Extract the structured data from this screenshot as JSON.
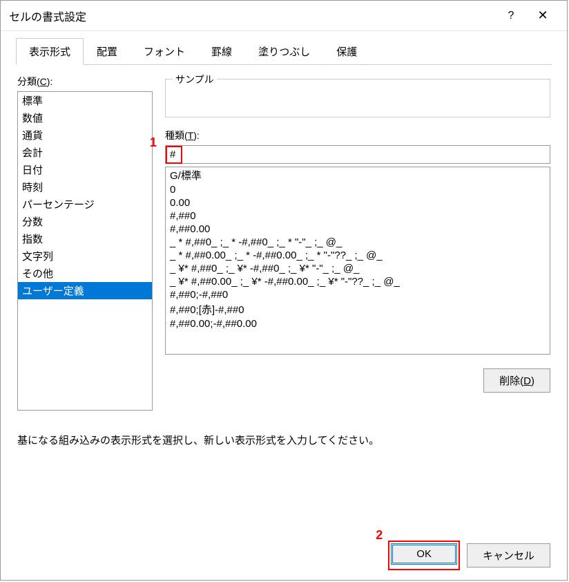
{
  "title": "セルの書式設定",
  "tabs": [
    "表示形式",
    "配置",
    "フォント",
    "罫線",
    "塗りつぶし",
    "保護"
  ],
  "active_tab": 0,
  "category_label_prefix": "分類(",
  "category_label_key": "C",
  "category_label_suffix": "):",
  "categories": [
    "標準",
    "数値",
    "通貨",
    "会計",
    "日付",
    "時刻",
    "パーセンテージ",
    "分数",
    "指数",
    "文字列",
    "その他",
    "ユーザー定義"
  ],
  "selected_category_index": 11,
  "sample_label": "サンプル",
  "type_label_prefix": "種類(",
  "type_label_key": "T",
  "type_label_suffix": "):",
  "type_value": "#",
  "format_codes": [
    "G/標準",
    "0",
    "0.00",
    "#,##0",
    "#,##0.00",
    "_ * #,##0_ ;_ * -#,##0_ ;_ * \"-\"_ ;_ @_",
    "_ * #,##0.00_ ;_ * -#,##0.00_ ;_ * \"-\"??_ ;_ @_",
    "_ ¥* #,##0_ ;_ ¥* -#,##0_ ;_ ¥* \"-\"_ ;_ @_",
    "_ ¥* #,##0.00_ ;_ ¥* -#,##0.00_ ;_ ¥* \"-\"??_ ;_ @_",
    "#,##0;-#,##0",
    "#,##0;[赤]-#,##0",
    "#,##0.00;-#,##0.00"
  ],
  "delete_label_prefix": "削除(",
  "delete_label_key": "D",
  "delete_label_suffix": ")",
  "hint": "基になる組み込みの表示形式を選択し、新しい表示形式を入力してください。",
  "ok_label": "OK",
  "cancel_label": "キャンセル",
  "help_glyph": "?",
  "close_glyph": "✕",
  "annotations": {
    "num1": "1",
    "num2": "2"
  }
}
